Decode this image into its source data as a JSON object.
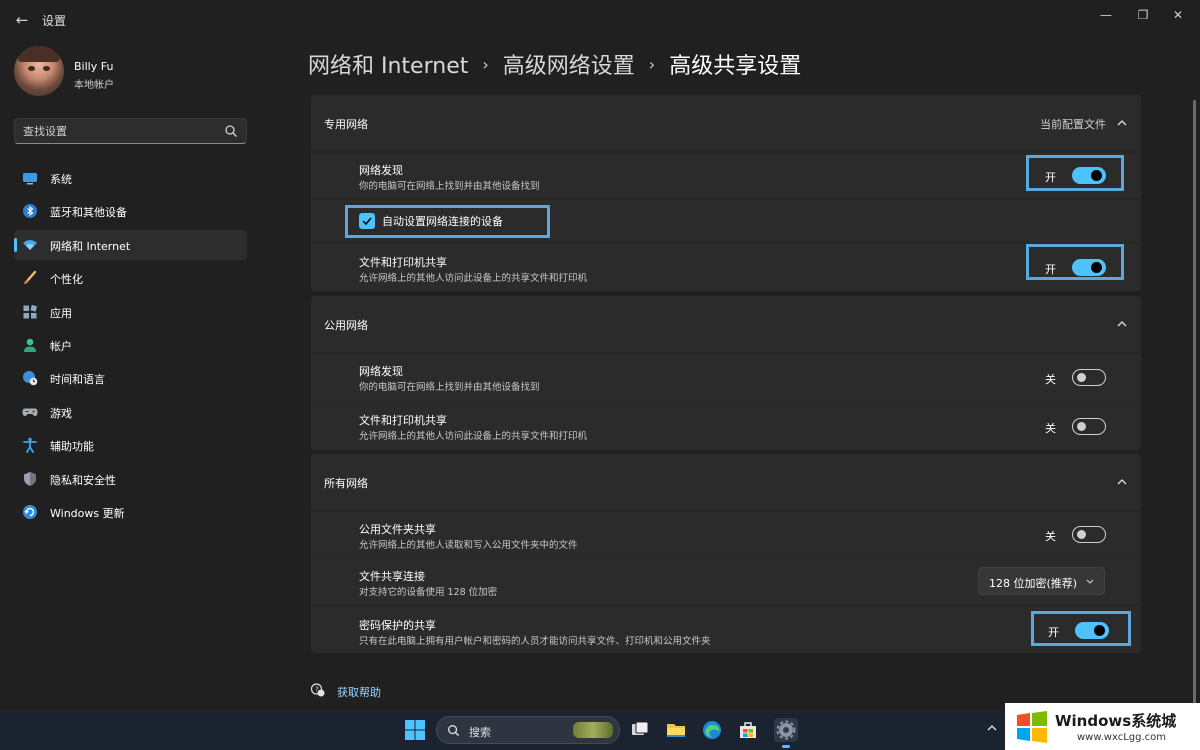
{
  "window": {
    "app_title": "设置",
    "back_icon": "←",
    "minimize": "—",
    "restore": "❐",
    "close": "✕"
  },
  "user": {
    "name": "Billy Fu",
    "account_type": "本地帐户"
  },
  "search": {
    "placeholder": "查找设置"
  },
  "nav": [
    {
      "label": "系统",
      "icon": "monitor-icon",
      "active": false
    },
    {
      "label": "蓝牙和其他设备",
      "icon": "bluetooth-icon",
      "active": false
    },
    {
      "label": "网络和 Internet",
      "icon": "wifi-icon",
      "active": true
    },
    {
      "label": "个性化",
      "icon": "paintbrush-icon",
      "active": false
    },
    {
      "label": "应用",
      "icon": "apps-icon",
      "active": false
    },
    {
      "label": "帐户",
      "icon": "person-icon",
      "active": false
    },
    {
      "label": "时间和语言",
      "icon": "globe-clock-icon",
      "active": false
    },
    {
      "label": "游戏",
      "icon": "gamepad-icon",
      "active": false
    },
    {
      "label": "辅助功能",
      "icon": "accessibility-icon",
      "active": false
    },
    {
      "label": "隐私和安全性",
      "icon": "shield-icon",
      "active": false
    },
    {
      "label": "Windows 更新",
      "icon": "windows-update-icon",
      "active": false
    }
  ],
  "breadcrumb": {
    "items": [
      "网络和 Internet",
      "高级网络设置",
      "高级共享设置"
    ],
    "separator": "›"
  },
  "private": {
    "title": "专用网络",
    "current_profile": "当前配置文件",
    "discovery": {
      "title": "网络发现",
      "desc": "你的电脑可在网络上找到并由其他设备找到",
      "state": "开",
      "on": true
    },
    "auto_setup": {
      "label": "自动设置网络连接的设备",
      "checked": true
    },
    "file_printer": {
      "title": "文件和打印机共享",
      "desc": "允许网络上的其他人访问此设备上的共享文件和打印机",
      "state": "开",
      "on": true
    }
  },
  "public": {
    "title": "公用网络",
    "discovery": {
      "title": "网络发现",
      "desc": "你的电脑可在网络上找到并由其他设备找到",
      "state": "关",
      "on": false
    },
    "file_printer": {
      "title": "文件和打印机共享",
      "desc": "允许网络上的其他人访问此设备上的共享文件和打印机",
      "state": "关",
      "on": false
    }
  },
  "all": {
    "title": "所有网络",
    "public_folder": {
      "title": "公用文件夹共享",
      "desc": "允许网络上的其他人读取和写入公用文件夹中的文件",
      "state": "关",
      "on": false
    },
    "file_sharing_connection": {
      "title": "文件共享连接",
      "desc": "对支持它的设备使用 128 位加密",
      "value": "128 位加密(推荐)"
    },
    "password_protected": {
      "title": "密码保护的共享",
      "desc": "只有在此电脑上拥有用户帐户和密码的人员才能访问共享文件、打印机和公用文件夹",
      "state": "开",
      "on": true
    }
  },
  "help": {
    "label": "获取帮助"
  },
  "taskbar": {
    "search_label": "搜索",
    "apps": [
      "task-view-icon",
      "file-explorer-icon",
      "edge-icon",
      "store-icon",
      "settings-icon"
    ]
  },
  "watermark": {
    "title": "Windows系统城",
    "url": "www.wxcLgg.com"
  },
  "colors": {
    "accent": "#4cc2ff",
    "background": "#202020",
    "card": "#2b2b2b",
    "highlight_box": "#5aa8dc"
  }
}
